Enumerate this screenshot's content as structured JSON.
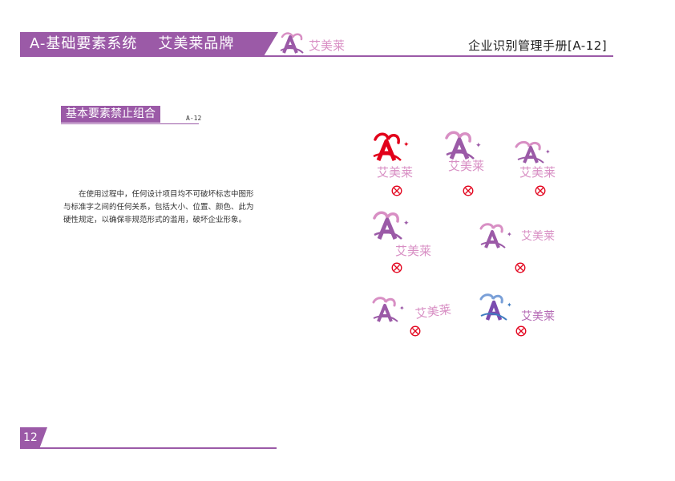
{
  "header": {
    "section_title": "A-基础要素系统",
    "brand_title": "艾美莱品牌",
    "logo_text": "艾美莱",
    "manual_title": "企业识别管理手册[A-12]"
  },
  "section": {
    "heading": "基本要素禁止组合",
    "code": "A-12"
  },
  "body_lines": [
    "在使用过程中，任何设计项目均不可破坏标志中图形",
    "与标准字之间的任何关系，包括大小、位置、颜色、此为",
    "硬性规定，以确保非规范形式的滥用，破坏企业形象。"
  ],
  "examples": [
    {
      "brand": "艾美莱",
      "icon": "prohibited-icon",
      "color": "#e2001a"
    },
    {
      "brand": "艾美莱",
      "icon": "prohibited-icon",
      "color": "#9b5aa7"
    },
    {
      "brand": "艾美莱",
      "icon": "prohibited-icon",
      "color": "#9b5aa7"
    },
    {
      "brand": "艾美莱",
      "icon": "prohibited-icon",
      "color": "#9b5aa7"
    },
    {
      "brand": "艾美莱",
      "icon": "prohibited-icon",
      "color": "#9b5aa7"
    },
    {
      "brand": "艾美莱",
      "icon": "prohibited-icon",
      "color": "#9b5aa7"
    },
    {
      "brand": "艾美莱",
      "icon": "prohibited-icon",
      "color": "#7b4bb0"
    }
  ],
  "colors": {
    "brand_purple": "#9b5aa7",
    "brand_pink": "#d88fc4",
    "warning_red": "#e2001a"
  },
  "footer": {
    "page_number": "12"
  }
}
